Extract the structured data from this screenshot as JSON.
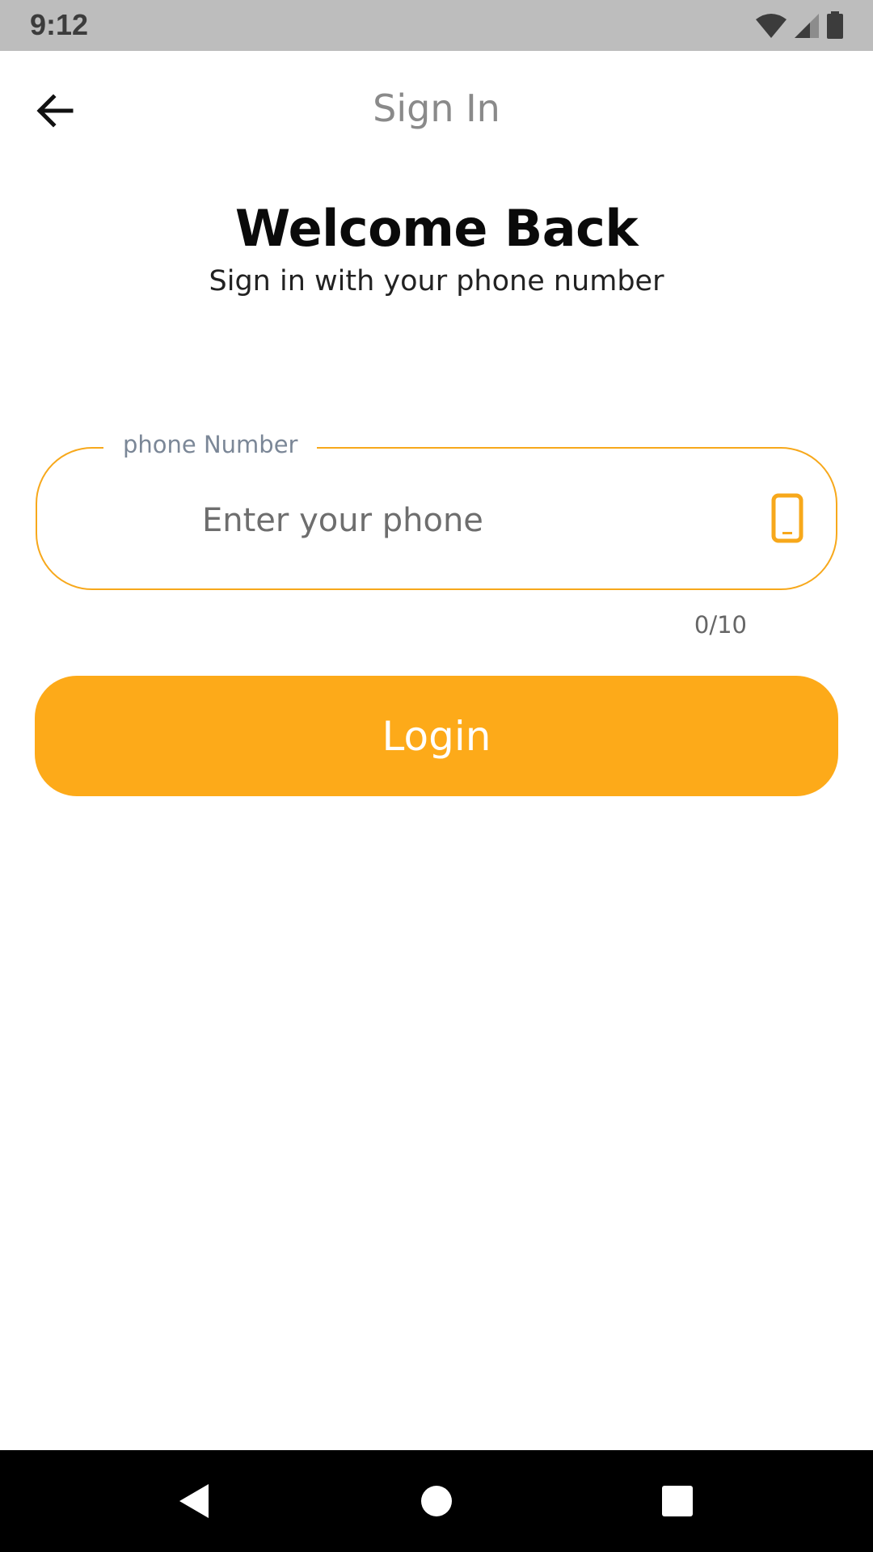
{
  "status_bar": {
    "time": "9:12",
    "icons": [
      "wifi-icon",
      "cell-signal-icon",
      "battery-icon"
    ]
  },
  "app_bar": {
    "title": "Sign In",
    "back_icon": "arrow-left-icon"
  },
  "header": {
    "title": "Welcome Back",
    "subtitle": "Sign in with your phone number"
  },
  "phone_field": {
    "label": "phone Number",
    "placeholder": "Enter your phone",
    "value": "",
    "icon": "smartphone-icon",
    "counter": "0/10"
  },
  "login_button": {
    "label": "Login"
  },
  "nav_bar": {
    "icons": [
      "nav-back-icon",
      "nav-home-icon",
      "nav-recents-icon"
    ]
  },
  "colors": {
    "accent": "#fdaa19",
    "field_border": "#f7a81b",
    "label": "#7b8797",
    "title_gray": "#8a8a8a"
  }
}
